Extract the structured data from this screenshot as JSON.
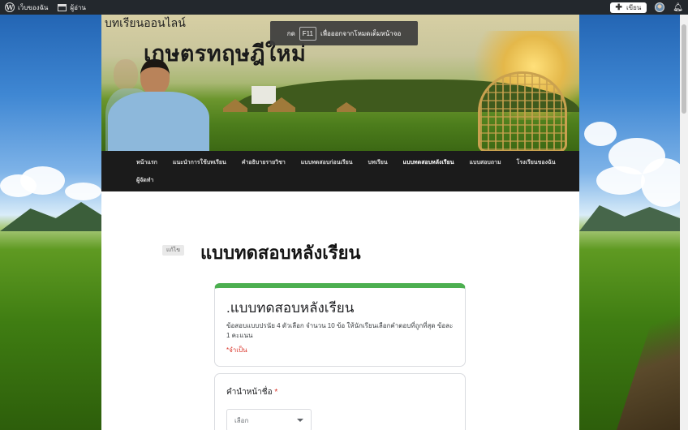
{
  "adminbar": {
    "my_site": "เว็บของฉัน",
    "reader": "ผู้อ่าน",
    "write": "เขียน"
  },
  "toast": {
    "press": "กด",
    "key": "F11",
    "message": "เพื่อออกจากโหมดเต็มหน้าจอ"
  },
  "site": {
    "description": "บทเรียนออนไลน์",
    "title": "เกษตรทฤษฎีใหม่"
  },
  "nav": {
    "items": [
      {
        "label": "หน้าแรก"
      },
      {
        "label": "แนะนำการใช้บทเรียน"
      },
      {
        "label": "คำอธิบายรายวิชา"
      },
      {
        "label": "แบบทดสอบก่อนเรียน"
      },
      {
        "label": "บทเรียน"
      },
      {
        "label": "แบบทดสอบหลังเรียน",
        "current": true
      },
      {
        "label": "แบบสอบถาม"
      },
      {
        "label": "โรงเรียนของฉัน"
      },
      {
        "label": "ผู้จัดทำ"
      }
    ]
  },
  "page": {
    "edit_label": "แก้ไข",
    "title": "แบบทดสอบหลังเรียน"
  },
  "form": {
    "title": ".แบบทดสอบหลังเรียน",
    "description": "ข้อสอบแบบปรนัย 4 ตัวเลือก จำนวน 10 ข้อ ให้นักเรียนเลือกคำตอบที่ถูกที่สุด ข้อละ 1 คะแนน",
    "required_note": "*จำเป็น",
    "question1": {
      "label": "คำนำหน้าชื่อ",
      "required_mark": "*",
      "select_placeholder": "เลือก"
    }
  },
  "colors": {
    "accent": "#4caf50",
    "required": "#d93025",
    "adminbar": "#23282d",
    "nav": "#1b1b1b"
  }
}
